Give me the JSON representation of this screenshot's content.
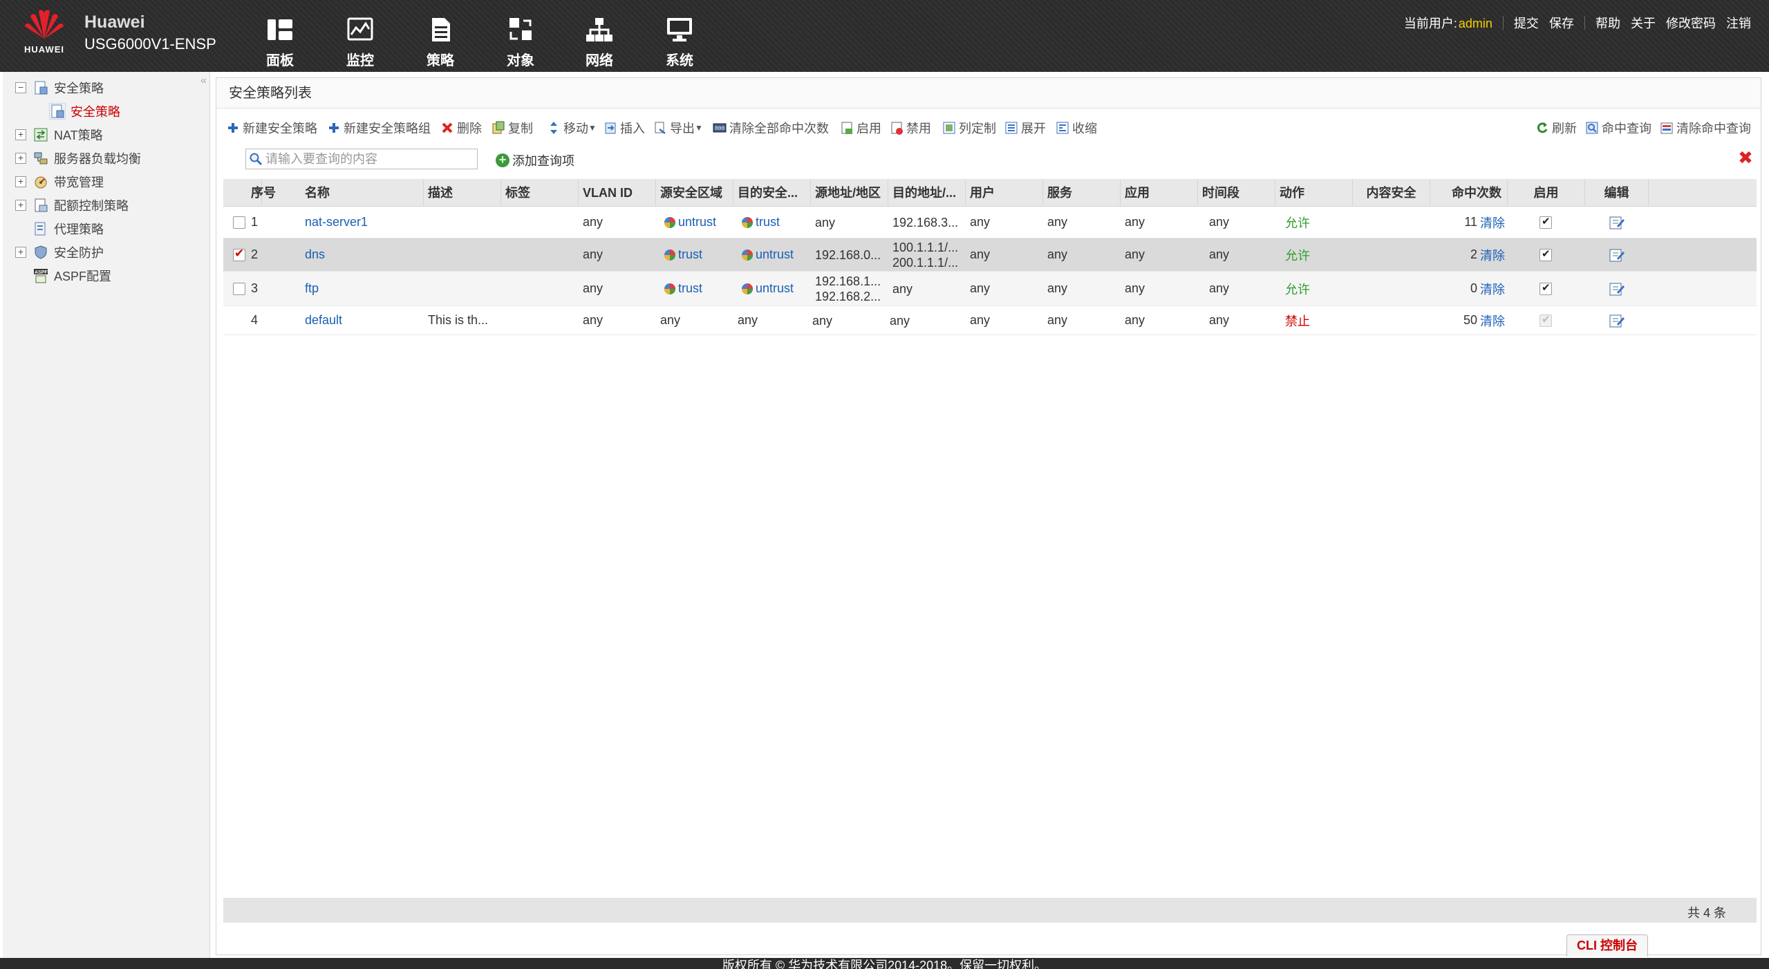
{
  "header": {
    "brand_name": "Huawei",
    "model": "USG6000V1-ENSP",
    "logo_text": "HUAWEI",
    "nav": [
      {
        "label": "面板",
        "icon": "dashboard-icon"
      },
      {
        "label": "监控",
        "icon": "monitor-icon"
      },
      {
        "label": "策略",
        "icon": "policy-icon"
      },
      {
        "label": "对象",
        "icon": "object-icon"
      },
      {
        "label": "网络",
        "icon": "network-icon"
      },
      {
        "label": "系统",
        "icon": "system-icon"
      }
    ],
    "current_user_label": "当前用户:",
    "current_user": "admin",
    "links": [
      "提交",
      "保存",
      "帮助",
      "关于",
      "修改密码",
      "注销"
    ]
  },
  "sidebar": {
    "items": [
      {
        "label": "安全策略",
        "expander": "−"
      },
      {
        "label": "安全策略",
        "expander": ""
      },
      {
        "label": "NAT策略",
        "expander": "+"
      },
      {
        "label": "服务器负载均衡",
        "expander": "+"
      },
      {
        "label": "带宽管理",
        "expander": "+"
      },
      {
        "label": "配额控制策略",
        "expander": "+"
      },
      {
        "label": "代理策略",
        "expander": ""
      },
      {
        "label": "安全防护",
        "expander": "+"
      },
      {
        "label": "ASPF配置",
        "expander": ""
      }
    ]
  },
  "panel": {
    "title": "安全策略列表",
    "toolbar": {
      "new_policy": "新建安全策略",
      "new_group": "新建安全策略组",
      "delete": "删除",
      "copy": "复制",
      "move": "移动",
      "insert": "插入",
      "export": "导出",
      "clear_hits": "清除全部命中次数",
      "enable": "启用",
      "disable": "禁用",
      "columns": "列定制",
      "expand": "展开",
      "collapse": "收缩",
      "refresh": "刷新",
      "hit_query": "命中查询",
      "clear_hit_query": "清除命中查询"
    },
    "search": {
      "placeholder": "请输入要查询的内容",
      "add_query": "添加查询项"
    },
    "table": {
      "headers": [
        "序号",
        "名称",
        "描述",
        "标签",
        "VLAN ID",
        "源安全区域",
        "目的安全...",
        "源地址/地区",
        "目的地址/...",
        "用户",
        "服务",
        "应用",
        "时间段",
        "动作",
        "内容安全",
        "命中次数",
        "启用",
        "编辑"
      ],
      "clear_label": "清除",
      "rows": [
        {
          "no": "1",
          "checked": false,
          "name": "nat-server1",
          "desc": "",
          "tag": "",
          "vlan": "any",
          "src_zone": "untrust",
          "dst_zone": "trust",
          "src_addr": [
            "any"
          ],
          "dst_addr": [
            "192.168.3..."
          ],
          "user": "any",
          "service": "any",
          "app": "any",
          "time": "any",
          "action": "允许",
          "action_type": "allow",
          "hits": "11",
          "enabled": true
        },
        {
          "no": "2",
          "checked": true,
          "name": "dns",
          "desc": "",
          "tag": "",
          "vlan": "any",
          "src_zone": "trust",
          "dst_zone": "untrust",
          "src_addr": [
            "192.168.0..."
          ],
          "dst_addr": [
            "100.1.1.1/...",
            "200.1.1.1/..."
          ],
          "user": "any",
          "service": "any",
          "app": "any",
          "time": "any",
          "action": "允许",
          "action_type": "allow",
          "hits": "2",
          "enabled": true
        },
        {
          "no": "3",
          "checked": false,
          "name": "ftp",
          "desc": "",
          "tag": "",
          "vlan": "any",
          "src_zone": "trust",
          "dst_zone": "untrust",
          "src_addr": [
            "192.168.1...",
            "192.168.2..."
          ],
          "dst_addr": [
            "any"
          ],
          "user": "any",
          "service": "any",
          "app": "any",
          "time": "any",
          "action": "允许",
          "action_type": "allow",
          "hits": "0",
          "enabled": true
        },
        {
          "no": "4",
          "checked": null,
          "name": "default",
          "desc": "This is th...",
          "tag": "",
          "vlan": "any",
          "src_zone": "any",
          "dst_zone": "any",
          "src_addr": [
            "any"
          ],
          "dst_addr": [
            "any"
          ],
          "user": "any",
          "service": "any",
          "app": "any",
          "time": "any",
          "action": "禁止",
          "action_type": "deny",
          "hits": "50",
          "enabled": "disabled"
        }
      ]
    },
    "total": "共 4 条"
  },
  "cli_button": "CLI 控制台",
  "copyright": "版权所有 © 华为技术有限公司2014-2018。保留一切权利。",
  "colors": {
    "allow": "#2d9e2d",
    "deny": "#cc0000",
    "link": "#1a5fb4",
    "username": "#f5d000",
    "header_bg": "#2b2b2b"
  }
}
